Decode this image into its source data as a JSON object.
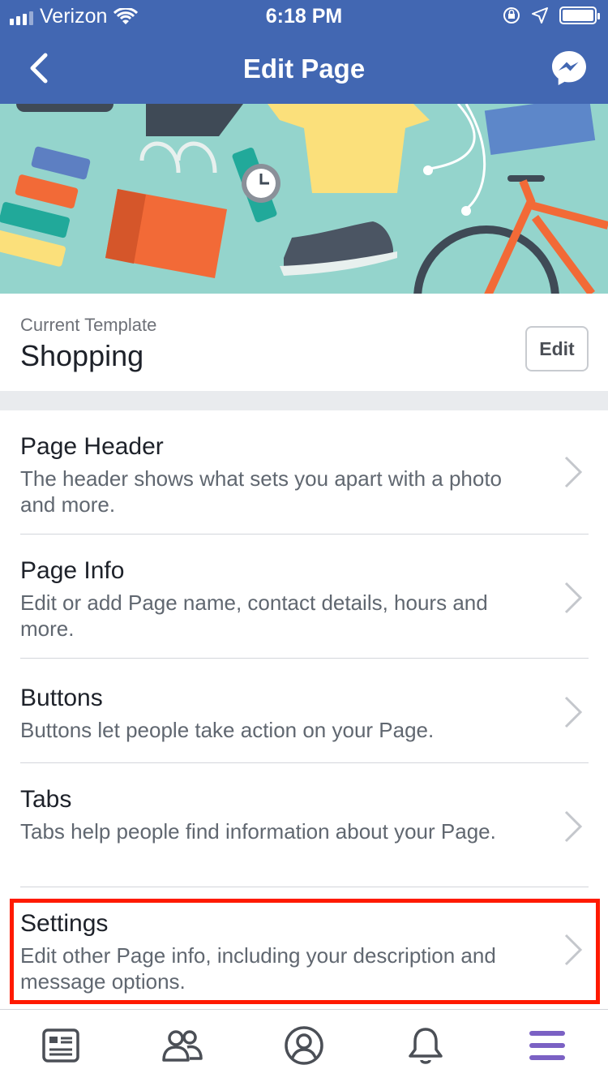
{
  "status_bar": {
    "carrier": "Verizon",
    "time": "6:18 PM"
  },
  "nav": {
    "title": "Edit Page",
    "back_icon": "chevron-left-icon",
    "right_icon": "messenger-icon"
  },
  "template": {
    "label": "Current Template",
    "name": "Shopping",
    "edit_label": "Edit"
  },
  "menu": [
    {
      "title": "Page Header",
      "desc": "The header shows what sets you apart with a photo and more."
    },
    {
      "title": "Page Info",
      "desc": "Edit or add Page name, contact details, hours and more."
    },
    {
      "title": "Buttons",
      "desc": "Buttons let people take action on your Page."
    },
    {
      "title": "Tabs",
      "desc": "Tabs help people find information about your Page."
    },
    {
      "title": "Settings",
      "desc": "Edit other Page info, including your description and message options."
    }
  ],
  "tabbar": {
    "tabs": [
      "news-feed-icon",
      "friends-icon",
      "profile-icon",
      "notifications-icon",
      "menu-icon"
    ],
    "active_color": "#7b61c4"
  },
  "colors": {
    "brand": "#4267b2",
    "highlight": "#ff1a00"
  }
}
